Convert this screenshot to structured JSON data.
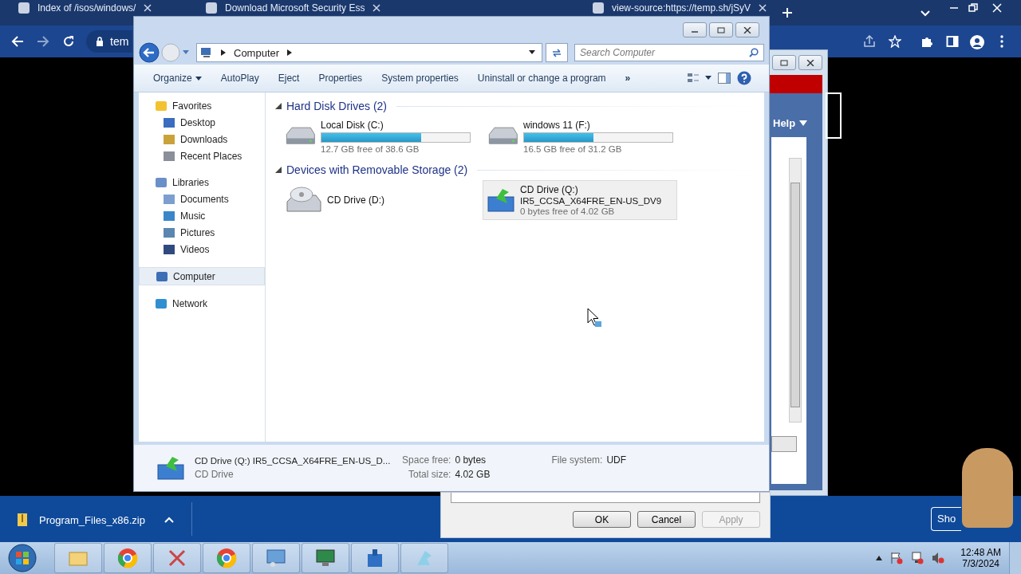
{
  "browser": {
    "tabs": [
      {
        "title": "Index of /isos/windows/"
      },
      {
        "title": "Download Microsoft Security Ess"
      },
      {
        "title": "view-source:https://temp.sh/jSyV"
      }
    ],
    "address": "tem"
  },
  "explorer": {
    "breadcrumb": "Computer",
    "search": {
      "placeholder": "Search Computer"
    },
    "toolbar": [
      {
        "label": "Organize",
        "kind": "menu"
      },
      {
        "label": "AutoPlay",
        "kind": "button"
      },
      {
        "label": "Eject",
        "kind": "button"
      },
      {
        "label": "Properties",
        "kind": "button"
      },
      {
        "label": "System properties",
        "kind": "button"
      },
      {
        "label": "Uninstall or change a program",
        "kind": "button"
      },
      {
        "label": "»",
        "kind": "more"
      }
    ],
    "sidebar": [
      {
        "label": "Favorites",
        "selected": false,
        "children": [
          {
            "label": "Desktop",
            "selected": false
          },
          {
            "label": "Downloads",
            "selected": false
          },
          {
            "label": "Recent Places",
            "selected": false
          }
        ]
      },
      {
        "label": "Libraries",
        "selected": false,
        "children": [
          {
            "label": "Documents",
            "selected": false
          },
          {
            "label": "Music",
            "selected": false
          },
          {
            "label": "Pictures",
            "selected": false
          },
          {
            "label": "Videos",
            "selected": false
          }
        ]
      },
      {
        "label": "Computer",
        "selected": true
      },
      {
        "label": "Network",
        "selected": false
      }
    ],
    "groups": [
      {
        "title": "Hard Disk Drives (2)",
        "items": [
          {
            "kind": "hdd",
            "label": "Local Disk (C:)",
            "level": 0.67,
            "free": "12.7 GB free of 38.6 GB",
            "selected": false
          },
          {
            "kind": "hdd",
            "label": "windows 11 (F:)",
            "level": 0.47,
            "free": "16.5 GB free of 31.2 GB",
            "selected": false
          }
        ]
      },
      {
        "title": "Devices with Removable Storage (2)",
        "items": [
          {
            "kind": "cd",
            "label": "CD Drive (D:)",
            "selected": false
          },
          {
            "kind": "disc",
            "label": "CD Drive (Q:)",
            "volume": "IR5_CCSA_X64FRE_EN-US_DV9",
            "free": "0 bytes free of 4.02 GB",
            "selected": true
          }
        ]
      }
    ],
    "details": {
      "name": "CD Drive (Q:) IR5_CCSA_X64FRE_EN-US_D...",
      "type": "CD Drive",
      "fields": [
        {
          "label": "Space free:",
          "value": "0 bytes"
        },
        {
          "label": "Total size:",
          "value": "4.02 GB"
        },
        {
          "label": "File system:",
          "value": "UDF"
        }
      ]
    }
  },
  "back_window": {
    "menu": "Help",
    "buttons": [
      {
        "label": "OK",
        "disabled": false
      },
      {
        "label": "Cancel",
        "disabled": false
      },
      {
        "label": "Apply",
        "disabled": true
      }
    ]
  },
  "download_bar": {
    "file": "Program_Files_x86.zip",
    "button": "Sho"
  },
  "taskbar": {
    "time": "12:48 AM",
    "date": "7/3/2024"
  }
}
